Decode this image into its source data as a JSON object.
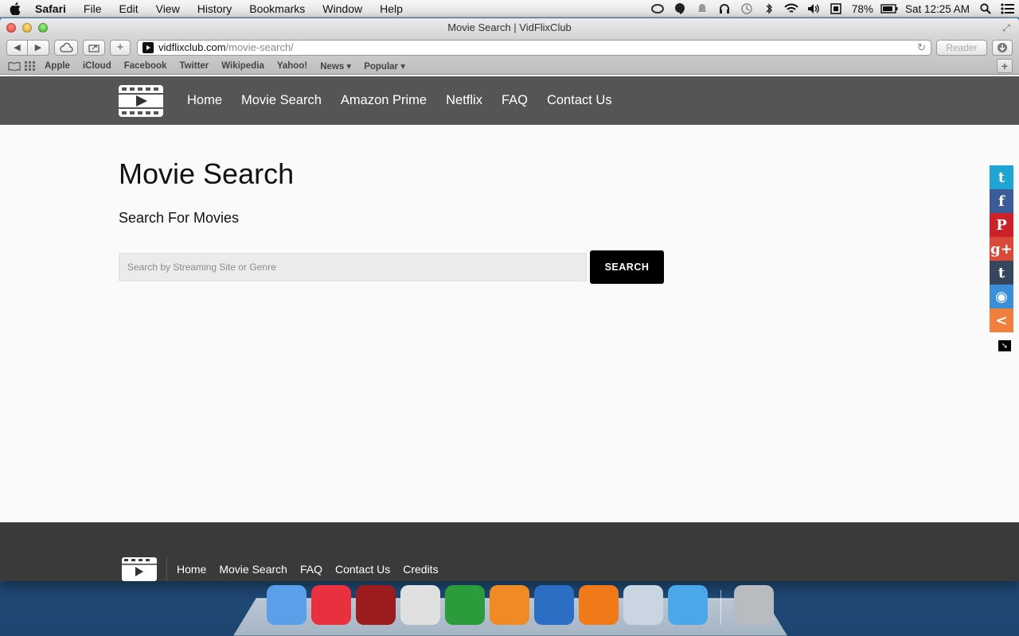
{
  "menubar": {
    "app_name": "Safari",
    "items": [
      "File",
      "Edit",
      "View",
      "History",
      "Bookmarks",
      "Window",
      "Help"
    ],
    "battery": "78%",
    "clock": "Sat 12:25 AM"
  },
  "window": {
    "title": "Movie Search | VidFlixClub"
  },
  "toolbar": {
    "url_domain": "vidflixclub.com",
    "url_path": "/movie-search/",
    "reader_label": "Reader"
  },
  "bookmarks": {
    "items": [
      "Apple",
      "iCloud",
      "Facebook",
      "Twitter",
      "Wikipedia",
      "Yahoo!",
      "News ▾",
      "Popular ▾"
    ]
  },
  "site_nav": {
    "links": [
      "Home",
      "Movie Search",
      "Amazon Prime",
      "Netflix",
      "FAQ",
      "Contact Us"
    ]
  },
  "main": {
    "title": "Movie Search",
    "subtitle": "Search For Movies",
    "search_placeholder": "Search by Streaming Site or Genre",
    "search_button": "SEARCH"
  },
  "footer": {
    "links": [
      "Home",
      "Movie Search",
      "FAQ",
      "Contact Us",
      "Credits"
    ]
  },
  "share_bar": {
    "buttons": [
      {
        "icon": "twitter-icon",
        "glyph": "t",
        "color": "#1ea5d4"
      },
      {
        "icon": "facebook-icon",
        "glyph": "f",
        "color": "#3b5b99"
      },
      {
        "icon": "pinterest-icon",
        "glyph": "P",
        "color": "#cd2129"
      },
      {
        "icon": "google-plus-icon",
        "glyph": "g+",
        "color": "#da4a38"
      },
      {
        "icon": "tumblr-icon",
        "glyph": "t",
        "color": "#36465d"
      },
      {
        "icon": "reddit-icon",
        "glyph": "◉",
        "color": "#3a8fd8"
      },
      {
        "icon": "share-icon",
        "glyph": "<",
        "color": "#f07e3c"
      }
    ]
  },
  "dock": {
    "apps": [
      {
        "icon": "finder-icon",
        "color": "#5aa0e8"
      },
      {
        "icon": "itunes-icon",
        "color": "#e8303f"
      },
      {
        "icon": "photo-booth-icon",
        "color": "#9b1c1c"
      },
      {
        "icon": "chrome-icon",
        "color": "#e0e0e0"
      },
      {
        "icon": "excel-icon",
        "color": "#2b9b3c"
      },
      {
        "icon": "settings-icon",
        "color": "#f08a24"
      },
      {
        "icon": "word-icon",
        "color": "#2c6ec4"
      },
      {
        "icon": "amazon-icon",
        "color": "#f07a1a"
      },
      {
        "icon": "safari-icon",
        "color": "#c9d6e2"
      },
      {
        "icon": "twitter-app-icon",
        "color": "#4aa8e8"
      },
      {
        "icon": "trash-icon",
        "color": "#b8bcc0"
      }
    ]
  }
}
